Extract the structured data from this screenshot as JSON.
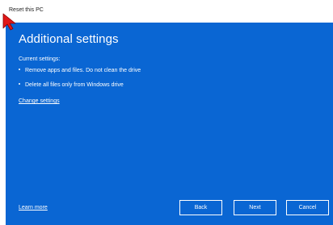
{
  "window": {
    "title": "Reset this PC"
  },
  "panel": {
    "heading": "Additional settings",
    "current_settings_label": "Current settings:",
    "settings": [
      "Remove apps and files. Do not clean the drive",
      "Delete all files only from Windows drive"
    ],
    "change_settings_link": "Change settings",
    "learn_more_link": "Learn more"
  },
  "buttons": {
    "back": "Back",
    "next": "Next",
    "cancel": "Cancel"
  },
  "icons": {
    "cursor": "arrow-cursor-icon"
  },
  "colors": {
    "panel_background": "#0a66d3",
    "text": "#ffffff",
    "cursor": "#e01818"
  }
}
